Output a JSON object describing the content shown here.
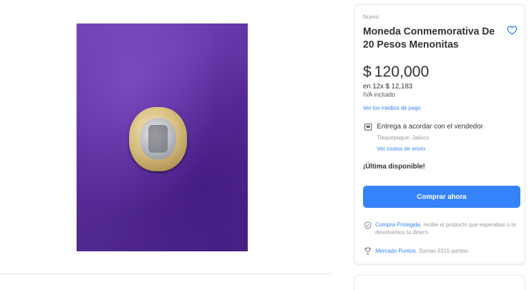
{
  "product": {
    "condition": "Nuevo",
    "title": "Moneda Conmemorativa De 20 Pesos Menonitas",
    "price": {
      "currency": "$",
      "amount": "120,000"
    },
    "installments": "en 12x $ 12,183",
    "tax_note": "IVA incluido",
    "payment_methods_link": "Ver los medios de pago"
  },
  "shipping": {
    "title": "Entrega a acordar con el vendedor",
    "location": "Tlaquepaque, Jalisco",
    "costs_link": "Ver costos de envío"
  },
  "stock": "¡Última disponible!",
  "actions": {
    "buy_now": "Comprar ahora"
  },
  "protection": {
    "link": "Compra Protegida",
    "text": ", recibe el producto que esperabas o te devolvemos tu dinero."
  },
  "points": {
    "link": "Mercado Puntos",
    "text": ". Sumas 6315 puntos."
  },
  "colors": {
    "accent": "#3483fa",
    "background_fabric": "#5a2d9c",
    "text_primary": "#333333",
    "text_muted": "#999999"
  },
  "icons": {
    "favorite": "heart-outline-icon",
    "shipping": "truck-icon",
    "protection": "shield-check-icon",
    "points": "trophy-icon"
  }
}
